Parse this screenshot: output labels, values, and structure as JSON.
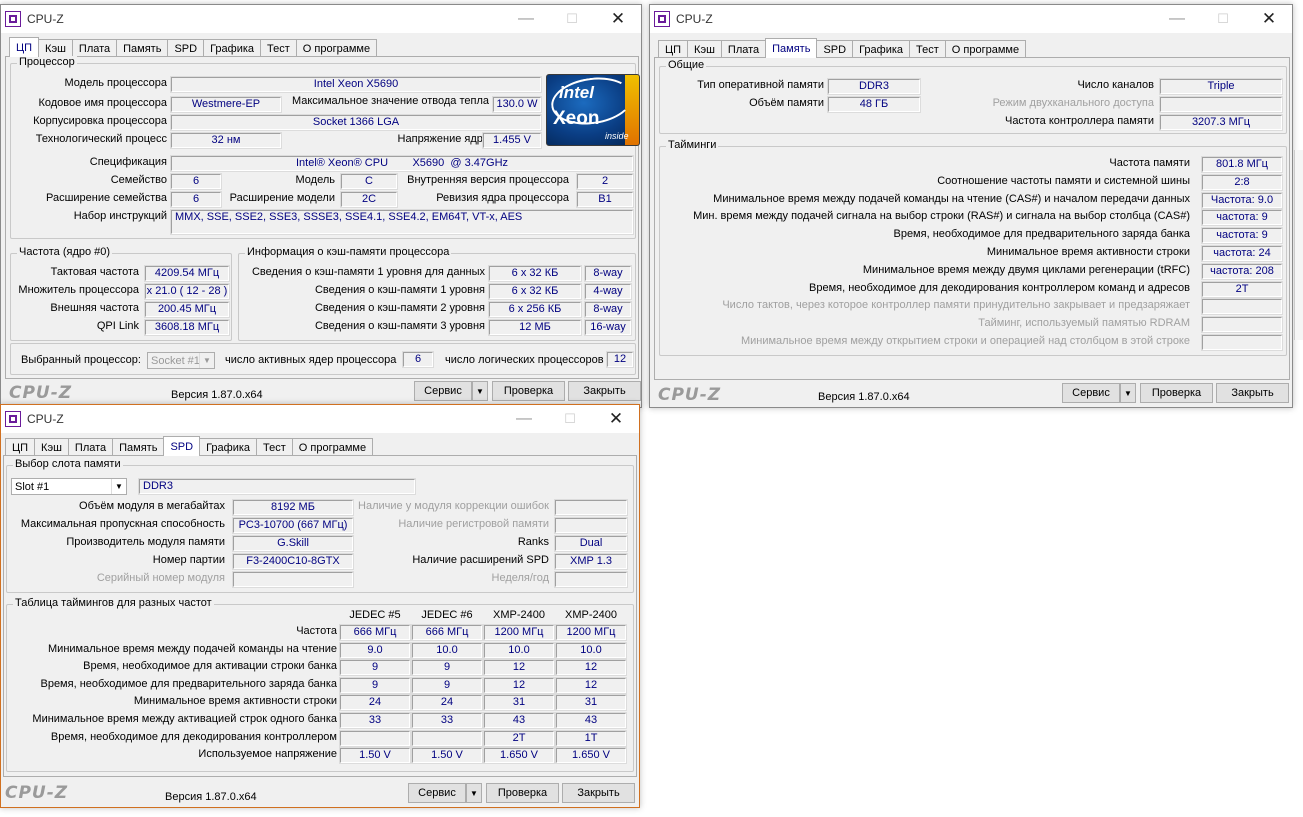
{
  "app_title": "CPU-Z",
  "tabs": [
    "ЦП",
    "Кэш",
    "Плата",
    "Память",
    "SPD",
    "Графика",
    "Тест",
    "О программе"
  ],
  "footer": {
    "logo": "CPU-Z",
    "version": "Версия 1.87.0.x64",
    "service": "Сервис",
    "check": "Проверка",
    "close": "Закрыть"
  },
  "w1": {
    "processor_title": "Процессор",
    "rows": {
      "model_label": "Модель процессора",
      "model": "Intel Xeon X5690",
      "codename_label": "Кодовое имя процессора",
      "codename": "Westmere-EP",
      "tdp_label": "Максимальное значение отвода тепла",
      "tdp": "130.0 W",
      "package_label": "Корпусировка процессора",
      "package": "Socket 1366 LGA",
      "tech_label": "Технологический процесс",
      "tech": "32 нм",
      "voltage_label": "Напряжение ядра",
      "voltage": "1.455 V",
      "spec_label": "Спецификация",
      "spec": "Intel® Xeon® CPU        X5690  @ 3.47GHz",
      "family_label": "Семейство",
      "family": "6",
      "model2_label": "Модель",
      "model2": "C",
      "stepping_label": "Внутренняя версия процессора",
      "stepping": "2",
      "extfam_label": "Расширение семейства",
      "extfam": "6",
      "extmod_label": "Расширение модели",
      "extmod": "2C",
      "revision_label": "Ревизия ядра процессора",
      "revision": "B1",
      "instr_label": "Набор инструкций",
      "instr": "MMX, SSE, SSE2, SSE3, SSSE3, SSE4.1, SSE4.2, EM64T, VT-x, AES"
    },
    "intel_logo": {
      "brand": "intel",
      "product": "Xeon",
      "tag": "inside"
    },
    "clocks_title": "Частота (ядро #0)",
    "clocks": {
      "core_label": "Тактовая частота",
      "core": "4209.54 МГц",
      "mult_label": "Множитель процессора",
      "mult": "x 21.0 ( 12 - 28 )",
      "bus_label": "Внешняя частота",
      "bus": "200.45 МГц",
      "qpi_label": "QPI Link",
      "qpi": "3608.18 МГц"
    },
    "cache_title": "Информация о кэш-памяти процессора",
    "cache": [
      {
        "label": "Сведения о кэш-памяти 1 уровня для данных",
        "size": "6 x 32 КБ",
        "way": "8-way"
      },
      {
        "label": "Сведения о кэш-памяти 1 уровня",
        "size": "6 x 32 КБ",
        "way": "4-way"
      },
      {
        "label": "Сведения о кэш-памяти 2 уровня",
        "size": "6 x 256 КБ",
        "way": "8-way"
      },
      {
        "label": "Сведения о кэш-памяти 3 уровня",
        "size": "12 МБ",
        "way": "16-way"
      }
    ],
    "selection": {
      "label": "Выбранный процессор:",
      "socket": "Socket #1",
      "cores_label": "число активных ядер процессора",
      "cores": "6",
      "threads_label": "число логических процессоров",
      "threads": "12"
    }
  },
  "w2": {
    "general_title": "Общие",
    "type_label": "Тип оперативной памяти",
    "type": "DDR3",
    "size_label": "Объём памяти",
    "size": "48 ГБ",
    "channels_label": "Число каналов",
    "channels": "Triple",
    "dc_label": "Режим двухканального доступа",
    "dc": "",
    "nb_label": "Частота контроллера памяти",
    "nb": "3207.3 МГц",
    "timings_title": "Тайминги",
    "timings": [
      {
        "label": "Частота памяти",
        "value": "801.8 МГц",
        "dis": false
      },
      {
        "label": "Соотношение частоты памяти и системной шины",
        "value": "2:8",
        "dis": false
      },
      {
        "label": "Минимальное время между подачей команды на чтение (CAS#) и началом передачи данных",
        "value": "Частота: 9.0",
        "dis": false
      },
      {
        "label": "Мин. время между подачей сигнала на выбор строки (RAS#) и сигнала на выбор столбца (CAS#)",
        "value": "частота: 9",
        "dis": false
      },
      {
        "label": "Время, необходимое для предварительного заряда банка",
        "value": "частота: 9",
        "dis": false
      },
      {
        "label": "Минимальное время активности строки",
        "value": "частота: 24",
        "dis": false
      },
      {
        "label": "Минимальное время между двумя циклами регенерации (tRFC)",
        "value": "частота: 208",
        "dis": false
      },
      {
        "label": "Время, необходимое для декодирования контроллером команд и адресов",
        "value": "2T",
        "dis": false
      },
      {
        "label": "Число тактов, через которое контроллер памяти принудительно закрывает и предзаряжает",
        "value": "",
        "dis": true
      },
      {
        "label": "Тайминг, используемый памятью RDRAM",
        "value": "",
        "dis": true
      },
      {
        "label": "Минимальное время между открытием строки и операцией над столбцом в этой строке",
        "value": "",
        "dis": true
      }
    ]
  },
  "w3": {
    "slot_title": "Выбор слота памяти",
    "slot": "Slot #1",
    "slot_type": "DDR3",
    "size_label": "Объём модуля в мегабайтах",
    "size": "8192 МБ",
    "bw_label": "Максимальная пропускная способность",
    "bw": "PC3-10700 (667 МГц)",
    "mfr_label": "Производитель модуля памяти",
    "mfr": "G.Skill",
    "part_label": "Номер партии",
    "part": "F3-2400C10-8GTX",
    "serial_label": "Серийный номер модуля",
    "serial": "",
    "ecc_label": "Наличие у модуля коррекции ошибок",
    "ecc": "",
    "reg_label": "Наличие регистровой памяти",
    "reg": "",
    "ranks_label": "Ranks",
    "ranks": "Dual",
    "spd_ext_label": "Наличие расширений SPD",
    "spd_ext": "XMP 1.3",
    "week_label": "Неделя/год",
    "week": "",
    "table_title": "Таблица таймингов для разных частот",
    "cols": [
      "JEDEC #5",
      "JEDEC #6",
      "XMP-2400",
      "XMP-2400"
    ],
    "rows": [
      {
        "label": "Частота",
        "v": [
          "666 МГц",
          "666 МГц",
          "1200 МГц",
          "1200 МГц"
        ]
      },
      {
        "label": "Минимальное время между подачей команды на чтение",
        "v": [
          "9.0",
          "10.0",
          "10.0",
          "10.0"
        ]
      },
      {
        "label": "Время, необходимое для активации строки банка",
        "v": [
          "9",
          "9",
          "12",
          "12"
        ]
      },
      {
        "label": "Время, необходимое для предварительного заряда банка",
        "v": [
          "9",
          "9",
          "12",
          "12"
        ]
      },
      {
        "label": "Минимальное время активности строки",
        "v": [
          "24",
          "24",
          "31",
          "31"
        ]
      },
      {
        "label": "Минимальное время между активацией строк одного банка",
        "v": [
          "33",
          "33",
          "43",
          "43"
        ]
      },
      {
        "label": "Время, необходимое для декодирования контроллером",
        "v": [
          "",
          "",
          "2T",
          "1T"
        ]
      },
      {
        "label": "Используемое напряжение",
        "v": [
          "1.50 V",
          "1.50 V",
          "1.650 V",
          "1.650 V"
        ]
      }
    ]
  }
}
